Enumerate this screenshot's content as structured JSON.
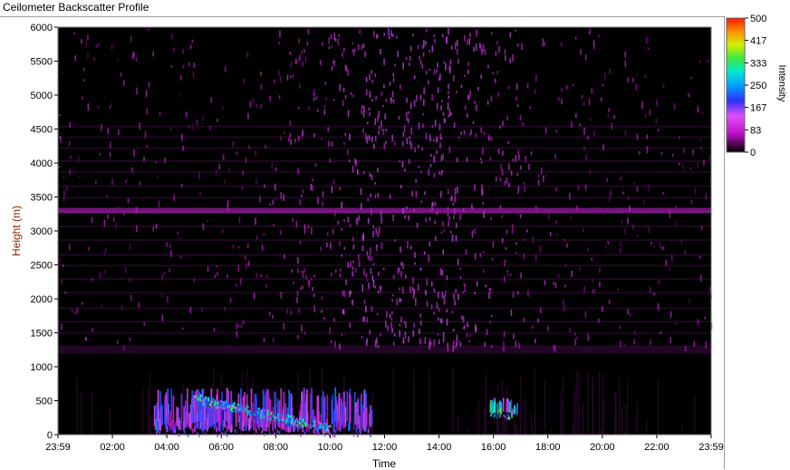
{
  "window": {
    "title": "Ceilometer Backscatter Profile"
  },
  "chart_data": {
    "type": "heatmap",
    "title": "Ceilometer Backscatter Profile",
    "xlabel": "Time",
    "ylabel": "Height (m)",
    "x_ticks": [
      "23:59",
      "02:00",
      "04:00",
      "06:00",
      "08:00",
      "10:00",
      "12:00",
      "14:00",
      "16:00",
      "18:00",
      "20:00",
      "22:00",
      "23:59"
    ],
    "y_ticks": [
      0,
      500,
      1000,
      1500,
      2000,
      2500,
      3000,
      3500,
      4000,
      4500,
      5000,
      5500,
      6000
    ],
    "ylim": [
      0,
      6000
    ],
    "colorbar": {
      "label": "Intensity",
      "ticks": [
        500,
        417,
        333,
        250,
        167,
        83,
        0
      ],
      "range": [
        0,
        500
      ]
    },
    "background_color": "#000000",
    "low_intensity_color": "#e020e0",
    "features": [
      {
        "name": "residual layer band",
        "height_m": 3300,
        "intensity": 90
      },
      {
        "name": "boundary layer base",
        "height_m": 1250,
        "intensity": 60
      },
      {
        "name": "aerosol layer 04:00-10:30",
        "time_start": "03:30",
        "time_end": "11:30",
        "height_m": [
          0,
          700
        ],
        "intensity": 180
      },
      {
        "name": "cloud returns 16:00-16:50",
        "time_start": "15:50",
        "time_end": "16:50",
        "height_m": [
          250,
          550
        ],
        "intensity": 300
      }
    ]
  }
}
